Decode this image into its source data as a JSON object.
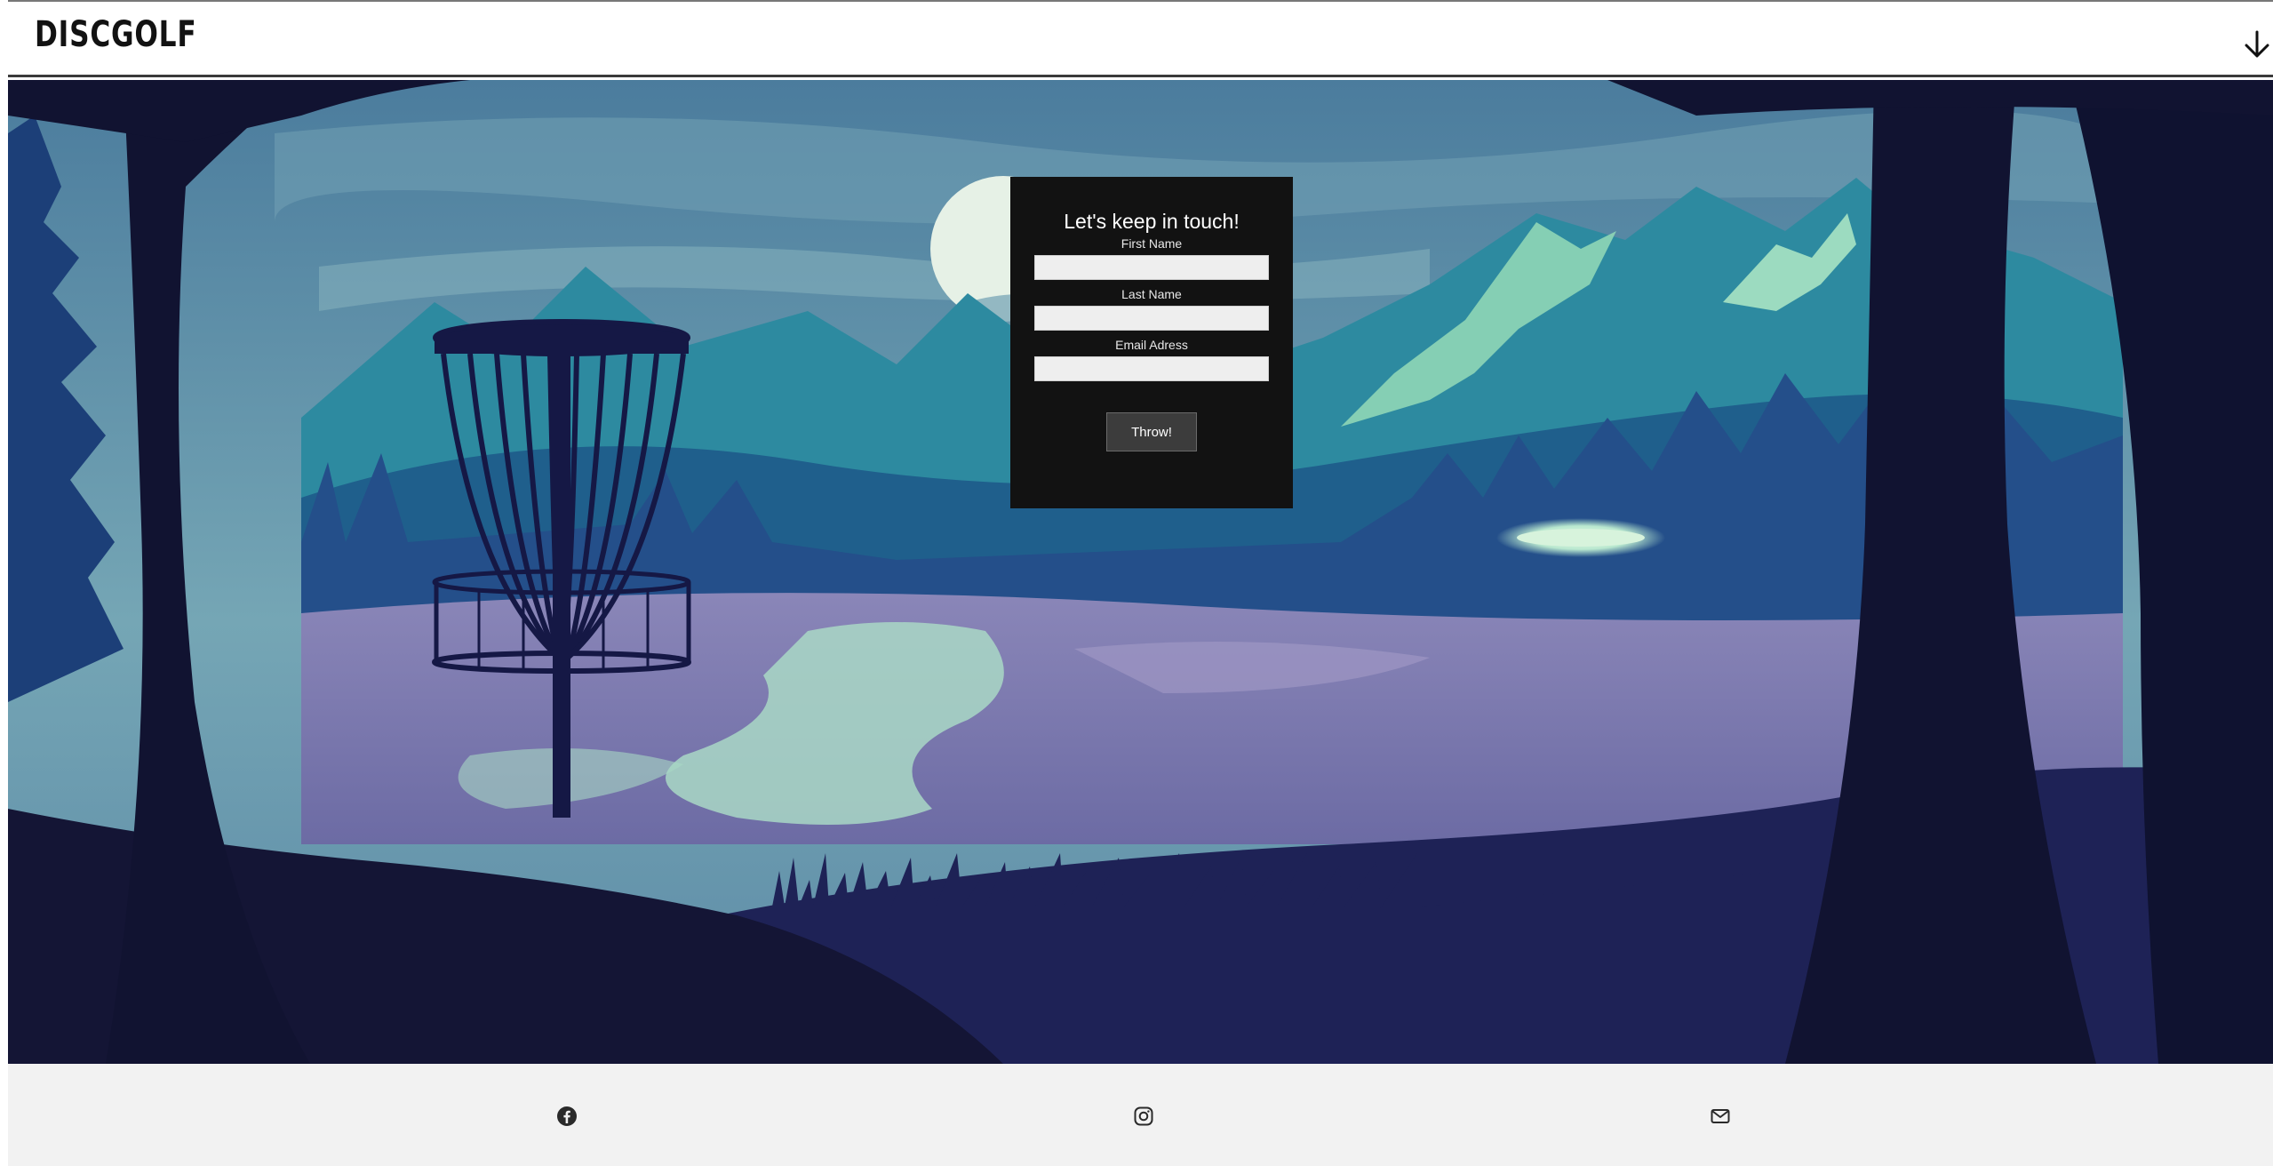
{
  "header": {
    "logo": "DISCGOLF",
    "scroll_icon": "arrow-down-icon"
  },
  "hero": {
    "illustration": "disc golf basket in night forest landscape with mountains, lake and flying disc"
  },
  "form": {
    "title": "Let's keep in touch!",
    "first_name_label": "First Name",
    "first_name_value": "",
    "last_name_label": "Last Name",
    "last_name_value": "",
    "email_label": "Email Adress",
    "email_value": "",
    "submit_label": "Throw!"
  },
  "footer": {
    "links": [
      {
        "icon": "facebook-icon"
      },
      {
        "icon": "instagram-icon"
      },
      {
        "icon": "mail-icon"
      }
    ]
  },
  "colors": {
    "form_background": "#121212",
    "footer_background": "#f2f2f2",
    "sky": "#5e93a9",
    "tree_silhouette": "#111331"
  }
}
